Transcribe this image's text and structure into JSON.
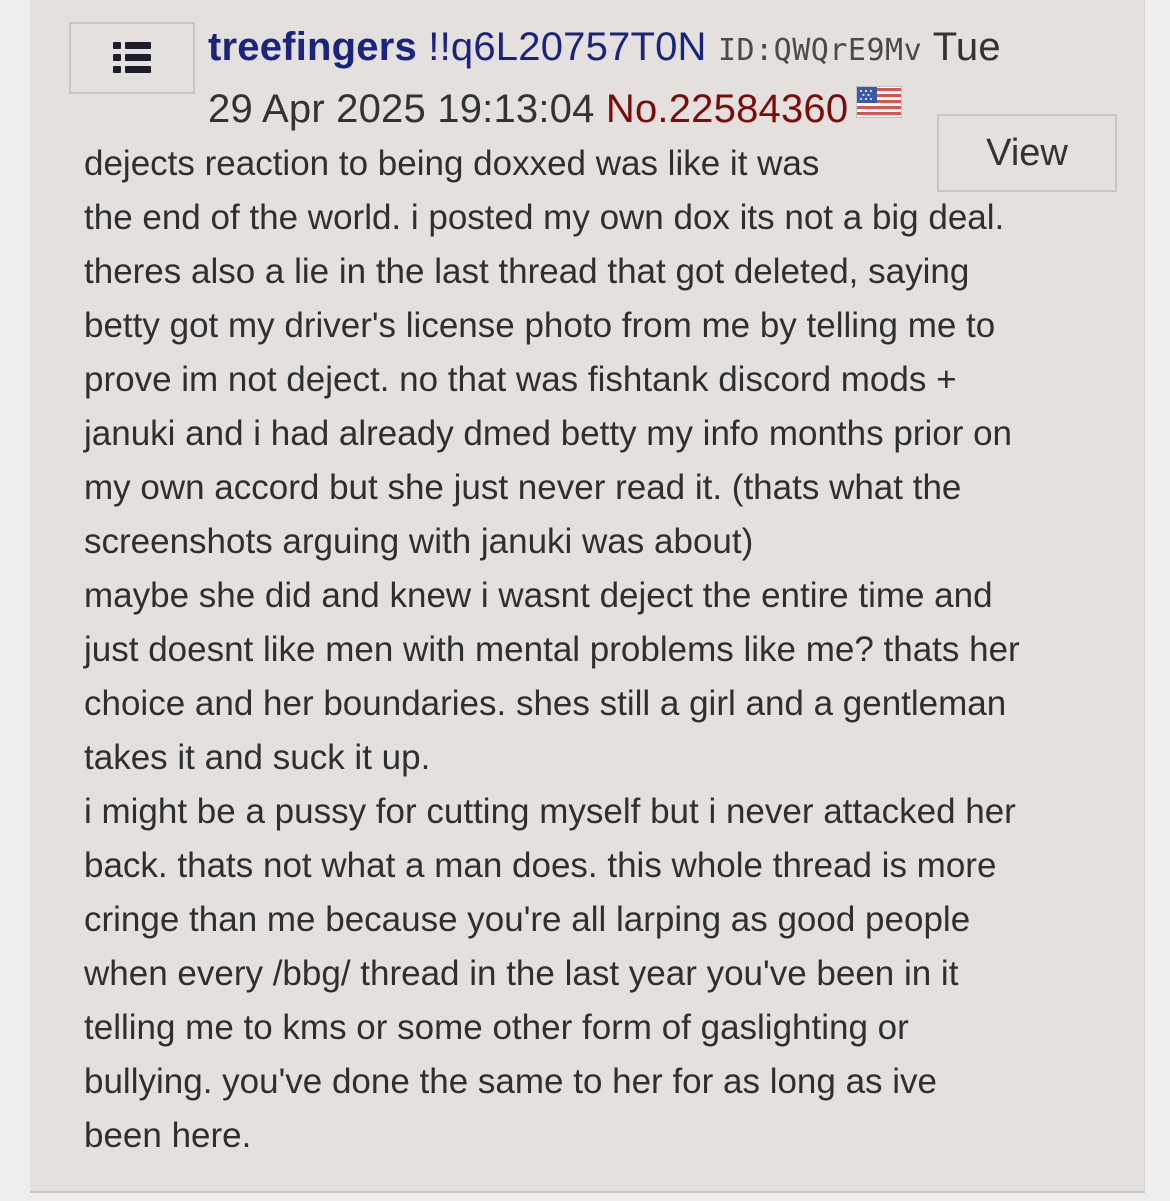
{
  "post": {
    "menu_icon": "list-icon",
    "name": "treefingers",
    "tripcode": "!!q6L20757T0N",
    "poster_id": "ID:QWQrE9Mv",
    "date_day": "Tue",
    "date_rest": "29 Apr 2025 19:13:04",
    "post_number": "No.22584360",
    "flag_icon": "us-flag-icon",
    "view_label": "View",
    "message_lines": [
      "dejects reaction to being doxxed was like it was",
      "the end of the world. i posted my own dox its not a big deal.",
      "theres also a lie in the last thread that got deleted, saying",
      "betty got my driver's license photo from me by telling me to",
      "prove im not deject. no that was fishtank discord mods +",
      "januki and i had already dmed betty my info months prior on",
      "my own accord but she just never read it. (thats what the",
      "screenshots arguing with januki was about)",
      "maybe she did and knew i wasnt deject the entire time and",
      "just doesnt like men with mental problems like me? thats her",
      "choice and her boundaries. shes still a girl and a gentleman",
      "takes it and suck it up.",
      "i might be a pussy for cutting myself but i never attacked her",
      "back. thats not what a man does. this whole thread is more",
      "cringe than me because you're all larping as good people",
      "when every /bbg/ thread in the last year you've been in it",
      "telling me to kms or some other form of gaslighting or",
      "bullying. you've done the same to her for as long as ive",
      "been here."
    ]
  },
  "colors": {
    "page_background": "#efeeee",
    "post_background": "#e3e0de",
    "name_color": "#1a237e",
    "post_number_color": "#7a0c0c",
    "text_color": "#2f2f2f"
  }
}
